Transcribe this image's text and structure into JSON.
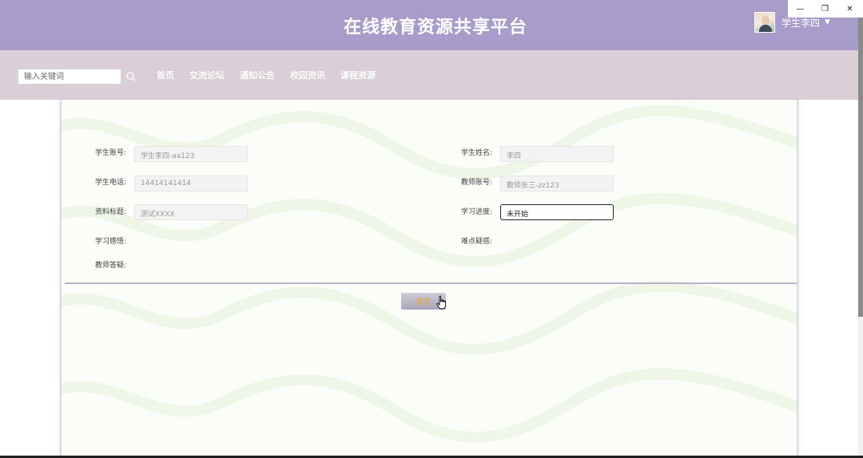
{
  "header": {
    "site_title": "在线教育资源共享平台",
    "username": "学生李四",
    "caret": "▼"
  },
  "window_controls": {
    "minimize": "—",
    "restore": "❐",
    "close": "✕"
  },
  "search": {
    "placeholder": "输入关键词",
    "icon": "search-icon"
  },
  "nav": {
    "links": [
      "首页",
      "交流论坛",
      "通知公告",
      "校园资讯",
      "课程资源"
    ]
  },
  "form": {
    "student_account": {
      "label": "学生账号:",
      "value": "学生李四-aa123"
    },
    "student_name": {
      "label": "学生姓名:",
      "value": "李四"
    },
    "student_phone": {
      "label": "学生电话:",
      "value": "14414141414"
    },
    "teacher_account": {
      "label": "教师账号:",
      "value": "教师张三-zz123"
    },
    "material_title": {
      "label": "资料标题:",
      "value": "测试XXXX"
    },
    "study_progress": {
      "label": "学习进度:",
      "value": "未开始"
    },
    "study_insight": {
      "label": "学习感悟:"
    },
    "difficult_questions": {
      "label": "难点疑惑:"
    },
    "teacher_answer": {
      "label": "教师答疑:"
    },
    "submit_label": "提交"
  },
  "colors": {
    "header_bg": "#a89ccb",
    "navbar_bg": "#dbcfd7",
    "submit_text": "#e0a32b"
  }
}
